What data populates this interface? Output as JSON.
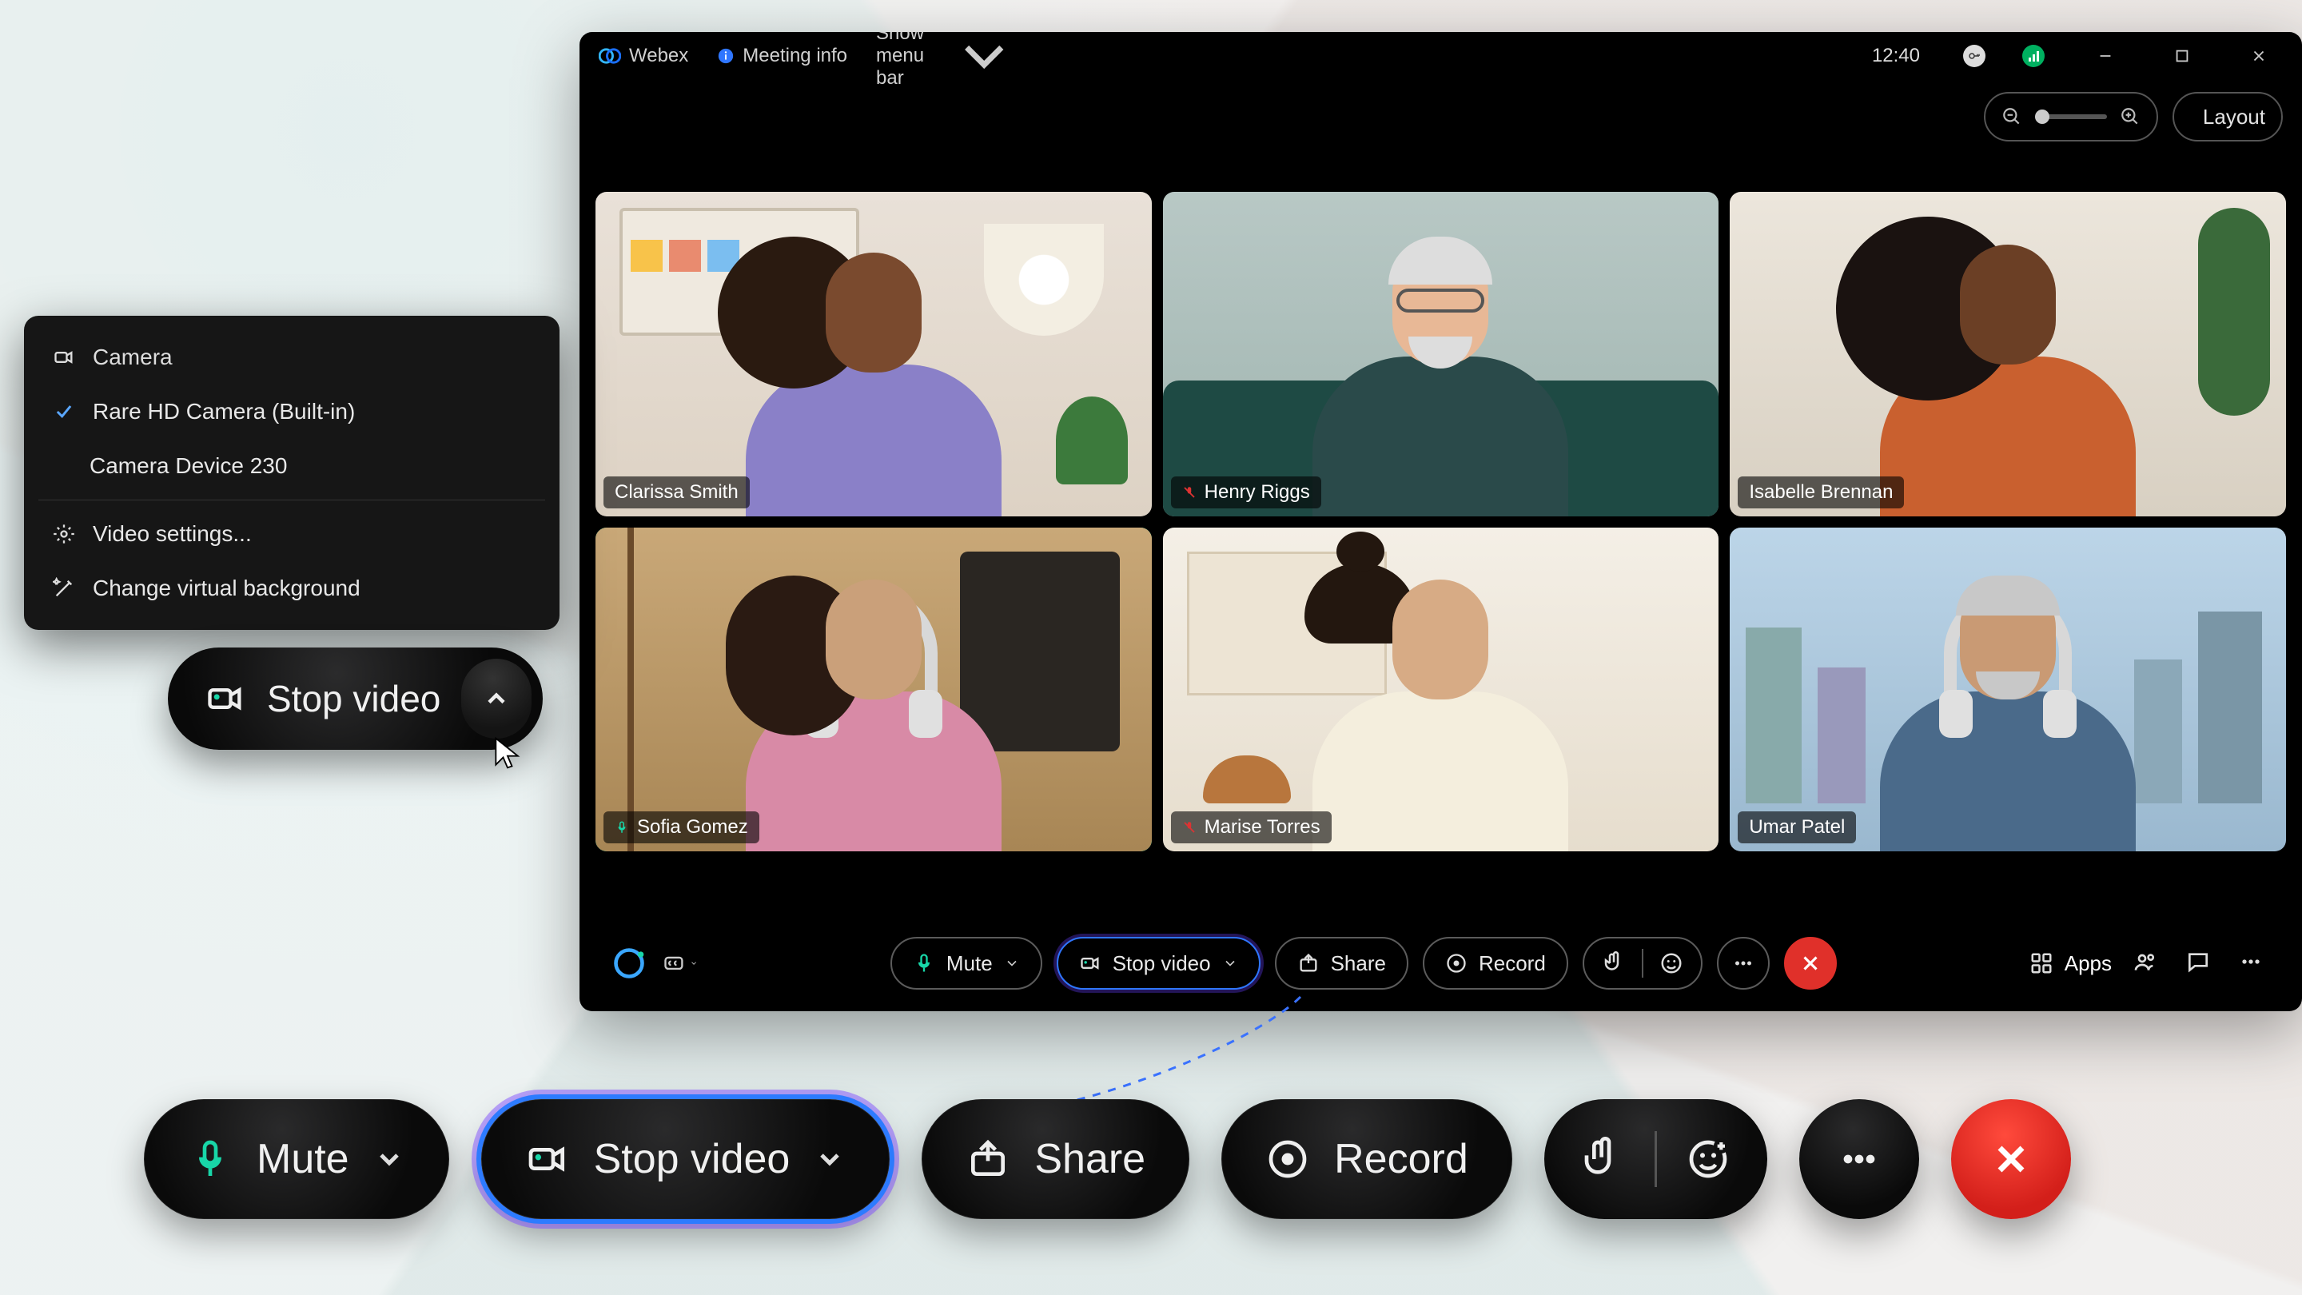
{
  "app": {
    "name": "Webex",
    "meeting_info": "Meeting info",
    "show_menu": "Show menu bar",
    "clock": "12:40",
    "layout_label": "Layout"
  },
  "participants": [
    {
      "name": "Clarissa Smith",
      "muted": false,
      "active": false
    },
    {
      "name": "Henry Riggs",
      "muted": true,
      "active": false
    },
    {
      "name": "Isabelle Brennan",
      "muted": false,
      "active": false
    },
    {
      "name": "Sofia Gomez",
      "muted": false,
      "active": true
    },
    {
      "name": "Marise Torres",
      "muted": true,
      "active": false
    },
    {
      "name": "Umar Patel",
      "muted": false,
      "active": false
    }
  ],
  "toolbar": {
    "mute": "Mute",
    "stop_video": "Stop video",
    "share": "Share",
    "record": "Record",
    "apps": "Apps"
  },
  "big": {
    "mute": "Mute",
    "stop_video": "Stop video",
    "share": "Share",
    "record": "Record"
  },
  "callout": {
    "label": "Stop video"
  },
  "popup": {
    "header": "Camera",
    "selected": "Rare HD Camera (Built-in)",
    "alt": "Camera Device 230",
    "settings": "Video settings...",
    "vbg": "Change virtual background"
  },
  "colors": {
    "accent": "#2f76ff",
    "speaking": "#18d6a8",
    "danger": "#e0302a",
    "muted": "#d33"
  }
}
